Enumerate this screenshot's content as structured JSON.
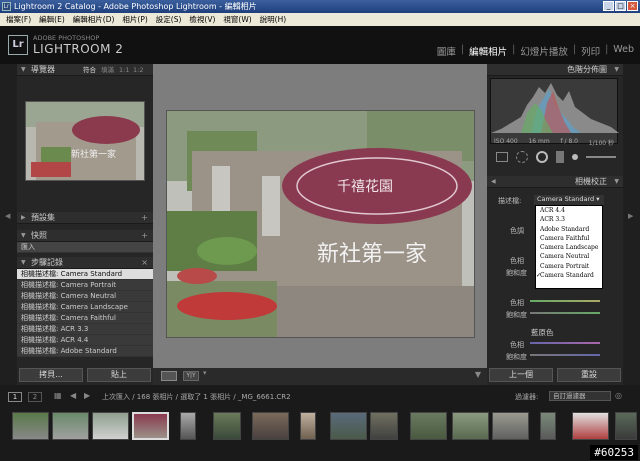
{
  "window": {
    "title": "Lightroom 2 Catalog - Adobe Photoshop Lightroom - 編輯相片",
    "icon_label": "Lr"
  },
  "menu": [
    "檔案(F)",
    "編輯(E)",
    "編輯相片(D)",
    "相片(P)",
    "設定(S)",
    "檢視(V)",
    "視窗(W)",
    "說明(H)"
  ],
  "brand": {
    "line1": "ADOBE PHOTOSHOP",
    "line2": "LIGHTROOM 2",
    "logo": "Lr"
  },
  "modules": {
    "library": "圖庫",
    "develop": "編輯相片",
    "slideshow": "幻燈片播放",
    "print": "列印",
    "web": "Web"
  },
  "left": {
    "navigator": {
      "title": "導覽器",
      "fit": "符合",
      "fill": "填滿",
      "one": "1:1",
      "ratio": "1:2"
    },
    "presets": "預設集",
    "snapshots": "快照",
    "snapshot_item": "匯入",
    "history": "步驟記錄",
    "history_items": [
      "相機描述檔: Camera Standard",
      "相機描述檔: Camera Portrait",
      "相機描述檔: Camera Neutral",
      "相機描述檔: Camera Landscape",
      "相機描述檔: Camera Faithful",
      "相機描述檔: ACR 3.3",
      "相機描述檔: ACR 4.4",
      "相機描述檔: Adobe Standard"
    ],
    "copy_btn": "拷貝...",
    "paste_btn": "貼上"
  },
  "right": {
    "histogram": "色階分佈圖",
    "exif": {
      "iso": "ISO 400",
      "focal": "16 mm",
      "aperture": "f / 8.0",
      "shutter": "1/100 秒"
    },
    "camera_calibration": "相機校正",
    "profile_label": "描述檔:",
    "profile_value": "Camera Standard",
    "profile_options": [
      "ACR 4.4",
      "ACR 3.3",
      "Adobe Standard",
      "Camera Faithful",
      "Camera Landscape",
      "Camera Neutral",
      "Camera Portrait",
      "Camera Standard"
    ],
    "shadow_label": "色調",
    "hue_label": "色相",
    "sat_label": "飽和度",
    "blue_primary": "藍原色",
    "prev_btn": "上一個",
    "reset_btn": "重設"
  },
  "filmstrip": {
    "info": "上次匯入 / 168 張相片 / 選取了 1 張相片 / _MG_6661.CR2",
    "filter_label": "過濾器:",
    "filter_value": "自訂過濾器",
    "page1": "1",
    "page2": "2"
  },
  "watermark": "#60253",
  "colors": {
    "bg": "#1a1a1a",
    "panel": "#262626",
    "center": "#7d7d7d"
  }
}
